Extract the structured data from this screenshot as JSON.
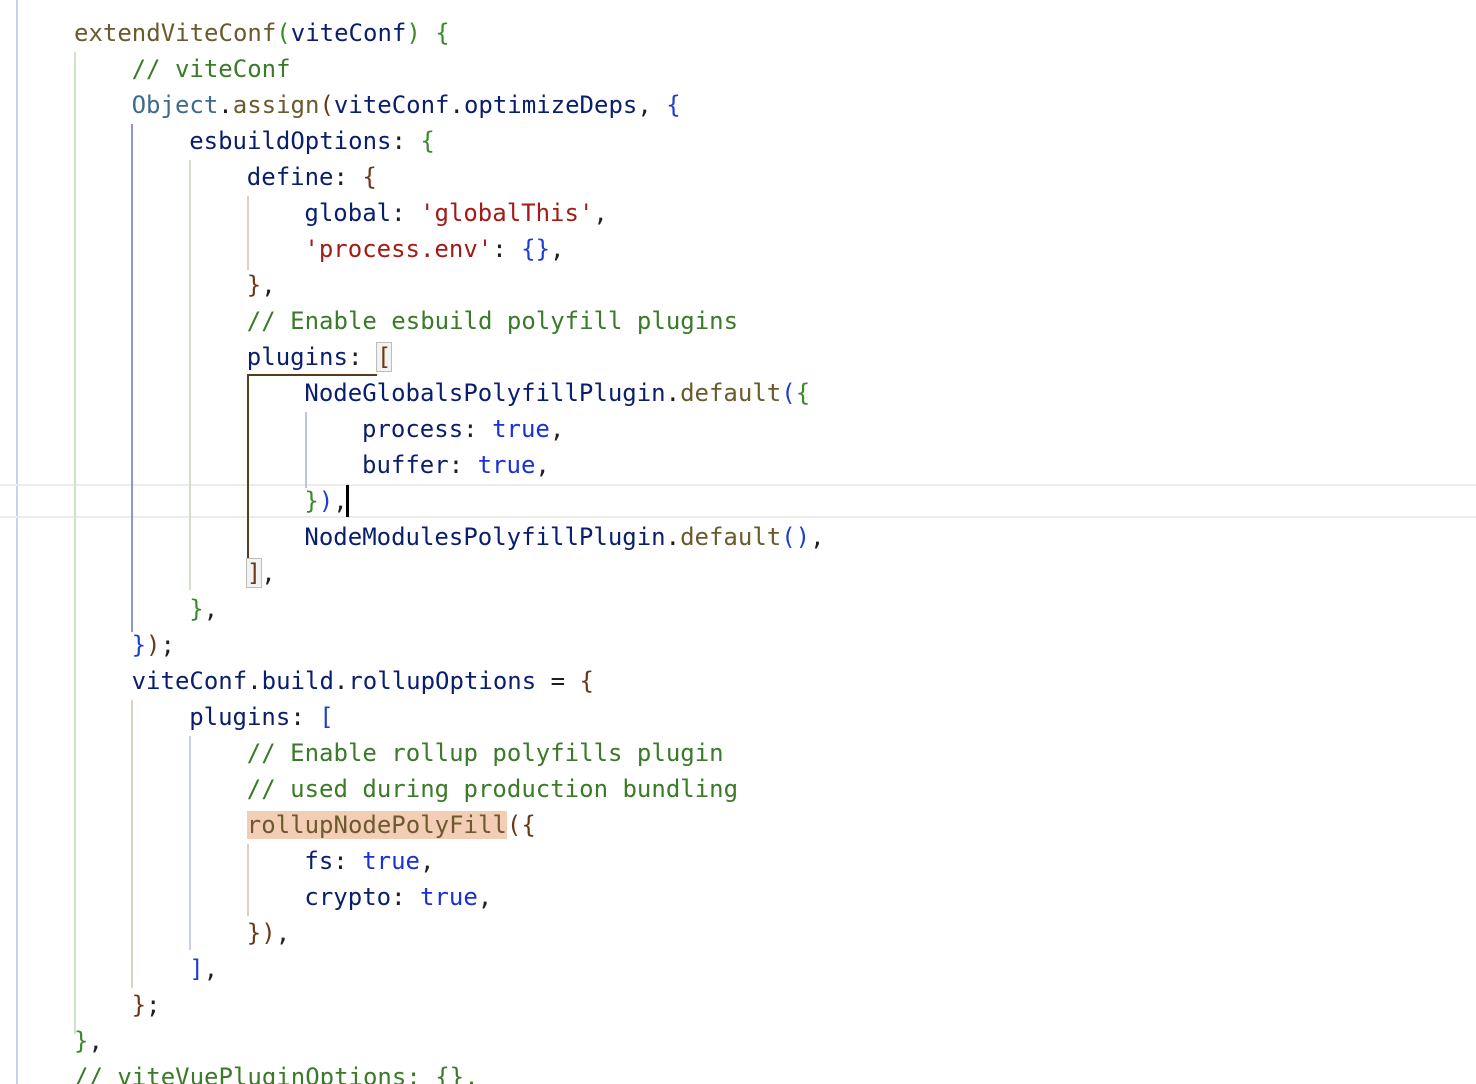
{
  "editor": {
    "lines": [
      {
        "row": 0,
        "indent": 0,
        "tokens": [
          {
            "t": "extendViteConf",
            "c": "fn"
          },
          {
            "t": "(",
            "c": "bg"
          },
          {
            "t": "viteConf",
            "c": "id"
          },
          {
            "t": ")",
            "c": "bg"
          },
          {
            "t": " ",
            "c": "punct"
          },
          {
            "t": "{",
            "c": "bg"
          }
        ]
      },
      {
        "row": 1,
        "indent": 1,
        "tokens": [
          {
            "t": "// viteConf",
            "c": "cm"
          }
        ]
      },
      {
        "row": 2,
        "indent": 1,
        "tokens": [
          {
            "t": "Object",
            "c": "cls"
          },
          {
            "t": ".",
            "c": "punct"
          },
          {
            "t": "assign",
            "c": "fn"
          },
          {
            "t": "(",
            "c": "bbr"
          },
          {
            "t": "viteConf",
            "c": "id"
          },
          {
            "t": ".",
            "c": "punct"
          },
          {
            "t": "optimizeDeps",
            "c": "id"
          },
          {
            "t": ", ",
            "c": "punct"
          },
          {
            "t": "{",
            "c": "bb"
          }
        ]
      },
      {
        "row": 3,
        "indent": 2,
        "tokens": [
          {
            "t": "esbuildOptions",
            "c": "id"
          },
          {
            "t": ": ",
            "c": "punct"
          },
          {
            "t": "{",
            "c": "bg"
          }
        ]
      },
      {
        "row": 4,
        "indent": 3,
        "tokens": [
          {
            "t": "define",
            "c": "id"
          },
          {
            "t": ": ",
            "c": "punct"
          },
          {
            "t": "{",
            "c": "bbr"
          }
        ]
      },
      {
        "row": 5,
        "indent": 4,
        "tokens": [
          {
            "t": "global",
            "c": "id"
          },
          {
            "t": ": ",
            "c": "punct"
          },
          {
            "t": "'globalThis'",
            "c": "str"
          },
          {
            "t": ",",
            "c": "punct"
          }
        ]
      },
      {
        "row": 6,
        "indent": 4,
        "tokens": [
          {
            "t": "'process.env'",
            "c": "str"
          },
          {
            "t": ": ",
            "c": "punct"
          },
          {
            "t": "{}",
            "c": "bb"
          },
          {
            "t": ",",
            "c": "punct"
          }
        ]
      },
      {
        "row": 7,
        "indent": 3,
        "tokens": [
          {
            "t": "}",
            "c": "bbr"
          },
          {
            "t": ",",
            "c": "punct"
          }
        ]
      },
      {
        "row": 8,
        "indent": 3,
        "tokens": [
          {
            "t": "// Enable esbuild polyfill plugins",
            "c": "cm"
          }
        ]
      },
      {
        "row": 9,
        "indent": 3,
        "tokens": [
          {
            "t": "plugins",
            "c": "id"
          },
          {
            "t": ": ",
            "c": "punct"
          },
          {
            "t": "[",
            "c": "bbr",
            "m": true
          }
        ]
      },
      {
        "row": 10,
        "indent": 4,
        "tokens": [
          {
            "t": "NodeGlobalsPolyfillPlugin",
            "c": "id"
          },
          {
            "t": ".",
            "c": "punct"
          },
          {
            "t": "default",
            "c": "fn"
          },
          {
            "t": "(",
            "c": "bb"
          },
          {
            "t": "{",
            "c": "bg"
          }
        ]
      },
      {
        "row": 11,
        "indent": 5,
        "tokens": [
          {
            "t": "process",
            "c": "id"
          },
          {
            "t": ": ",
            "c": "punct"
          },
          {
            "t": "true",
            "c": "kw"
          },
          {
            "t": ",",
            "c": "punct"
          }
        ]
      },
      {
        "row": 12,
        "indent": 5,
        "tokens": [
          {
            "t": "buffer",
            "c": "id"
          },
          {
            "t": ": ",
            "c": "punct"
          },
          {
            "t": "true",
            "c": "kw"
          },
          {
            "t": ",",
            "c": "punct"
          }
        ]
      },
      {
        "row": 13,
        "indent": 4,
        "tokens": [
          {
            "t": "}",
            "c": "bg"
          },
          {
            "t": ")",
            "c": "bb"
          },
          {
            "t": ",",
            "c": "punct"
          }
        ]
      },
      {
        "row": 14,
        "indent": 4,
        "tokens": [
          {
            "t": "NodeModulesPolyfillPlugin",
            "c": "id"
          },
          {
            "t": ".",
            "c": "punct"
          },
          {
            "t": "default",
            "c": "fn"
          },
          {
            "t": "()",
            "c": "bb"
          },
          {
            "t": ",",
            "c": "punct"
          }
        ]
      },
      {
        "row": 15,
        "indent": 3,
        "tokens": [
          {
            "t": "]",
            "c": "bbr",
            "m": true
          },
          {
            "t": ",",
            "c": "punct"
          }
        ]
      },
      {
        "row": 16,
        "indent": 2,
        "tokens": [
          {
            "t": "}",
            "c": "bg"
          },
          {
            "t": ",",
            "c": "punct"
          }
        ]
      },
      {
        "row": 17,
        "indent": 1,
        "tokens": [
          {
            "t": "}",
            "c": "bb"
          },
          {
            "t": ")",
            "c": "bbr"
          },
          {
            "t": ";",
            "c": "punct"
          }
        ]
      },
      {
        "row": 18,
        "indent": 1,
        "tokens": [
          {
            "t": "viteConf",
            "c": "id"
          },
          {
            "t": ".",
            "c": "punct"
          },
          {
            "t": "build",
            "c": "id"
          },
          {
            "t": ".",
            "c": "punct"
          },
          {
            "t": "rollupOptions",
            "c": "id"
          },
          {
            "t": " = ",
            "c": "punct"
          },
          {
            "t": "{",
            "c": "bbr"
          }
        ]
      },
      {
        "row": 19,
        "indent": 2,
        "tokens": [
          {
            "t": "plugins",
            "c": "id"
          },
          {
            "t": ": ",
            "c": "punct"
          },
          {
            "t": "[",
            "c": "bb"
          }
        ]
      },
      {
        "row": 20,
        "indent": 3,
        "tokens": [
          {
            "t": "// Enable rollup polyfills plugin",
            "c": "cm"
          }
        ]
      },
      {
        "row": 21,
        "indent": 3,
        "tokens": [
          {
            "t": "// used during production bundling",
            "c": "cm"
          }
        ]
      },
      {
        "row": 22,
        "indent": 3,
        "tokens": [
          {
            "t": "rollupNodePolyFill",
            "c": "fn",
            "h": true
          },
          {
            "t": "(",
            "c": "bbr"
          },
          {
            "t": "{",
            "c": "bbr"
          }
        ]
      },
      {
        "row": 23,
        "indent": 4,
        "tokens": [
          {
            "t": "fs",
            "c": "id"
          },
          {
            "t": ": ",
            "c": "punct"
          },
          {
            "t": "true",
            "c": "kw"
          },
          {
            "t": ",",
            "c": "punct"
          }
        ]
      },
      {
        "row": 24,
        "indent": 4,
        "tokens": [
          {
            "t": "crypto",
            "c": "id"
          },
          {
            "t": ": ",
            "c": "punct"
          },
          {
            "t": "true",
            "c": "kw"
          },
          {
            "t": ",",
            "c": "punct"
          }
        ]
      },
      {
        "row": 25,
        "indent": 3,
        "tokens": [
          {
            "t": "}",
            "c": "bbr"
          },
          {
            "t": ")",
            "c": "bbr"
          },
          {
            "t": ",",
            "c": "punct"
          }
        ]
      },
      {
        "row": 26,
        "indent": 2,
        "tokens": [
          {
            "t": "]",
            "c": "bb"
          },
          {
            "t": ",",
            "c": "punct"
          }
        ]
      },
      {
        "row": 27,
        "indent": 1,
        "tokens": [
          {
            "t": "}",
            "c": "bbr"
          },
          {
            "t": ";",
            "c": "punct"
          }
        ]
      },
      {
        "row": 28,
        "indent": 0,
        "tokens": [
          {
            "t": "}",
            "c": "bg"
          },
          {
            "t": ",",
            "c": "punct"
          }
        ]
      },
      {
        "row": 29,
        "indent": 0,
        "tokens": [
          {
            "t": "// viteVuePluginOptions: {},",
            "c": "cm"
          }
        ]
      }
    ]
  }
}
